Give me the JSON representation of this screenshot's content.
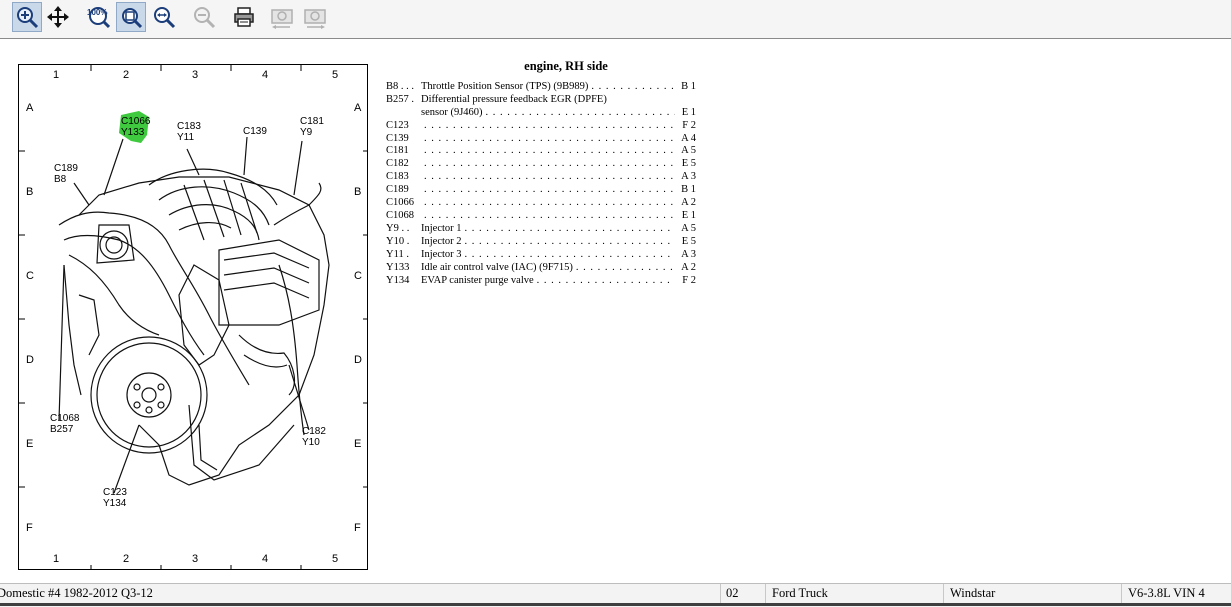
{
  "toolbar": {
    "buttons": [
      {
        "id": "zoom-in",
        "icon": "zoom-in-icon",
        "active": true
      },
      {
        "id": "pan",
        "icon": "move-arrows-icon",
        "active": false
      },
      {
        "id": "actual-size",
        "icon": "zoom-100-icon",
        "label": "100%",
        "active": false
      },
      {
        "id": "zoom-fit",
        "icon": "zoom-fit-icon",
        "active": true
      },
      {
        "id": "zoom-width",
        "icon": "zoom-width-icon",
        "active": false
      },
      {
        "id": "zoom-out",
        "icon": "zoom-out-icon",
        "active": false
      },
      {
        "id": "print",
        "icon": "printer-icon",
        "active": false
      },
      {
        "id": "prev-page",
        "icon": "camera-back-icon",
        "active": false
      },
      {
        "id": "next-page",
        "icon": "camera-forward-icon",
        "active": false
      }
    ]
  },
  "diagram": {
    "cols": [
      "1",
      "2",
      "3",
      "4",
      "5"
    ],
    "rows": [
      "A",
      "B",
      "C",
      "D",
      "E",
      "F"
    ],
    "callouts": {
      "c1066": "C1066",
      "y133": "Y133",
      "c183": "C183",
      "y11": "Y11",
      "c139": "C139",
      "c181": "C181",
      "y9": "Y9",
      "c189": "C189",
      "b8": "B8",
      "c1068": "C1068",
      "b257": "B257",
      "c182": "C182",
      "y10": "Y10",
      "c123": "C123",
      "y134": "Y134"
    },
    "highlight_color": "#3ec93e"
  },
  "legend": {
    "title": "engine, RH side",
    "rows": [
      {
        "code": "B8 . . .",
        "desc": "Throttle Position Sensor (TPS) (9B989)",
        "loc": "B 1"
      },
      {
        "code": "B257 .",
        "desc": "Differential pressure feedback EGR (DPFE)",
        "loc": ""
      },
      {
        "code": "",
        "desc": "sensor (9J460)",
        "loc": "E 1"
      },
      {
        "code": "C123",
        "desc": "",
        "loc": "F 2"
      },
      {
        "code": "C139",
        "desc": "",
        "loc": "A 4"
      },
      {
        "code": "C181",
        "desc": "",
        "loc": "A 5"
      },
      {
        "code": "C182",
        "desc": "",
        "loc": "E 5"
      },
      {
        "code": "C183",
        "desc": "",
        "loc": "A 3"
      },
      {
        "code": "C189",
        "desc": "",
        "loc": "B 1"
      },
      {
        "code": "C1066",
        "desc": "",
        "loc": "A 2"
      },
      {
        "code": "C1068",
        "desc": "",
        "loc": "E 1"
      },
      {
        "code": "Y9 . .",
        "desc": "Injector 1",
        "loc": "A 5"
      },
      {
        "code": "Y10 .",
        "desc": "Injector 2",
        "loc": "E 5"
      },
      {
        "code": "Y11 .",
        "desc": "Injector 3",
        "loc": "A 3"
      },
      {
        "code": "Y133",
        "desc": "Idle air control valve (IAC) (9F715)",
        "loc": "A 2"
      },
      {
        "code": "Y134",
        "desc": "EVAP canister purge valve",
        "loc": "F 2"
      }
    ]
  },
  "statusbar": {
    "database": "Domestic #4 1982-2012 Q3-12",
    "code": "02",
    "make": "Ford Truck",
    "model": "Windstar",
    "engine": "V6-3.8L VIN 4"
  }
}
